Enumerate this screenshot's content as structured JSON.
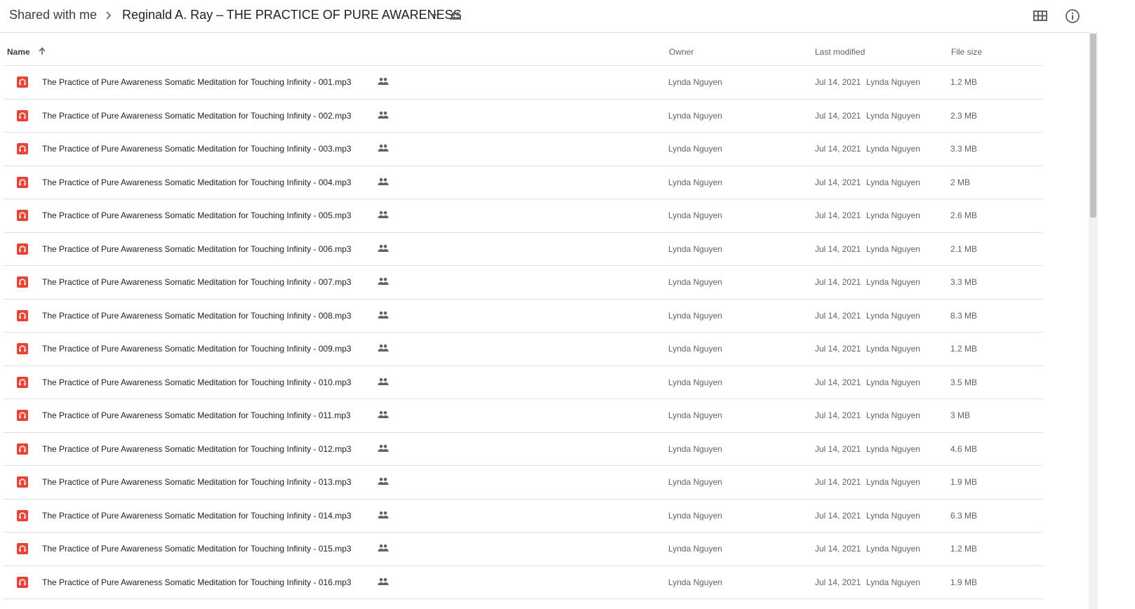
{
  "breadcrumb": {
    "root": "Shared with me",
    "current": "Reginald A. Ray – THE PRACTICE OF PURE AWARENESS"
  },
  "icons": {
    "separator": "chevron-right-icon",
    "folder_menu": "caret-down-icon",
    "shared": "people-icon",
    "view_toggle": "grid-view-icon",
    "info": "info-icon",
    "sort": "arrow-up-icon",
    "file": "audio-file-icon"
  },
  "colors": {
    "file_icon": "#ea4335",
    "text_primary": "#202124",
    "text_secondary": "#5f6368",
    "divider": "#e0e0e0"
  },
  "columns": {
    "name": "Name",
    "owner": "Owner",
    "last_modified": "Last modified",
    "file_size": "File size"
  },
  "files": [
    {
      "name": "The Practice of Pure Awareness Somatic Meditation for Touching Infinity - 001.mp3",
      "owner": "Lynda Nguyen",
      "modified": "Jul 14, 2021",
      "modified_by": "Lynda Nguyen",
      "size": "1.2 MB"
    },
    {
      "name": "The Practice of Pure Awareness Somatic Meditation for Touching Infinity - 002.mp3",
      "owner": "Lynda Nguyen",
      "modified": "Jul 14, 2021",
      "modified_by": "Lynda Nguyen",
      "size": "2.3 MB"
    },
    {
      "name": "The Practice of Pure Awareness Somatic Meditation for Touching Infinity - 003.mp3",
      "owner": "Lynda Nguyen",
      "modified": "Jul 14, 2021",
      "modified_by": "Lynda Nguyen",
      "size": "3.3 MB"
    },
    {
      "name": "The Practice of Pure Awareness Somatic Meditation for Touching Infinity - 004.mp3",
      "owner": "Lynda Nguyen",
      "modified": "Jul 14, 2021",
      "modified_by": "Lynda Nguyen",
      "size": "2 MB"
    },
    {
      "name": "The Practice of Pure Awareness Somatic Meditation for Touching Infinity - 005.mp3",
      "owner": "Lynda Nguyen",
      "modified": "Jul 14, 2021",
      "modified_by": "Lynda Nguyen",
      "size": "2.6 MB"
    },
    {
      "name": "The Practice of Pure Awareness Somatic Meditation for Touching Infinity - 006.mp3",
      "owner": "Lynda Nguyen",
      "modified": "Jul 14, 2021",
      "modified_by": "Lynda Nguyen",
      "size": "2.1 MB"
    },
    {
      "name": "The Practice of Pure Awareness Somatic Meditation for Touching Infinity - 007.mp3",
      "owner": "Lynda Nguyen",
      "modified": "Jul 14, 2021",
      "modified_by": "Lynda Nguyen",
      "size": "3.3 MB"
    },
    {
      "name": "The Practice of Pure Awareness Somatic Meditation for Touching Infinity - 008.mp3",
      "owner": "Lynda Nguyen",
      "modified": "Jul 14, 2021",
      "modified_by": "Lynda Nguyen",
      "size": "8.3 MB"
    },
    {
      "name": "The Practice of Pure Awareness Somatic Meditation for Touching Infinity - 009.mp3",
      "owner": "Lynda Nguyen",
      "modified": "Jul 14, 2021",
      "modified_by": "Lynda Nguyen",
      "size": "1.2 MB"
    },
    {
      "name": "The Practice of Pure Awareness Somatic Meditation for Touching Infinity - 010.mp3",
      "owner": "Lynda Nguyen",
      "modified": "Jul 14, 2021",
      "modified_by": "Lynda Nguyen",
      "size": "3.5 MB"
    },
    {
      "name": "The Practice of Pure Awareness Somatic Meditation for Touching Infinity - 011.mp3",
      "owner": "Lynda Nguyen",
      "modified": "Jul 14, 2021",
      "modified_by": "Lynda Nguyen",
      "size": "3 MB"
    },
    {
      "name": "The Practice of Pure Awareness Somatic Meditation for Touching Infinity - 012.mp3",
      "owner": "Lynda Nguyen",
      "modified": "Jul 14, 2021",
      "modified_by": "Lynda Nguyen",
      "size": "4.6 MB"
    },
    {
      "name": "The Practice of Pure Awareness Somatic Meditation for Touching Infinity - 013.mp3",
      "owner": "Lynda Nguyen",
      "modified": "Jul 14, 2021",
      "modified_by": "Lynda Nguyen",
      "size": "1.9 MB"
    },
    {
      "name": "The Practice of Pure Awareness Somatic Meditation for Touching Infinity - 014.mp3",
      "owner": "Lynda Nguyen",
      "modified": "Jul 14, 2021",
      "modified_by": "Lynda Nguyen",
      "size": "6.3 MB"
    },
    {
      "name": "The Practice of Pure Awareness Somatic Meditation for Touching Infinity - 015.mp3",
      "owner": "Lynda Nguyen",
      "modified": "Jul 14, 2021",
      "modified_by": "Lynda Nguyen",
      "size": "1.2 MB"
    },
    {
      "name": "The Practice of Pure Awareness Somatic Meditation for Touching Infinity - 016.mp3",
      "owner": "Lynda Nguyen",
      "modified": "Jul 14, 2021",
      "modified_by": "Lynda Nguyen",
      "size": "1.9 MB"
    }
  ]
}
